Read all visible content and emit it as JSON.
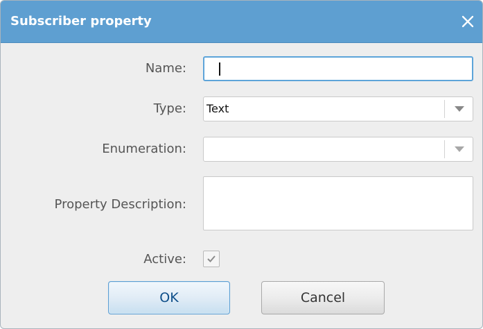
{
  "dialog": {
    "title": "Subscriber property",
    "close_icon": "close-icon",
    "title_bar_color": "#5e9fd1"
  },
  "form": {
    "name": {
      "label": "Name:",
      "value": ""
    },
    "type": {
      "label": "Type:",
      "value": "Text"
    },
    "enumeration": {
      "label": "Enumeration:",
      "value": ""
    },
    "description": {
      "label": "Property Description:",
      "value": ""
    },
    "active": {
      "label": "Active:",
      "checked": true
    }
  },
  "buttons": {
    "ok": "OK",
    "cancel": "Cancel"
  }
}
